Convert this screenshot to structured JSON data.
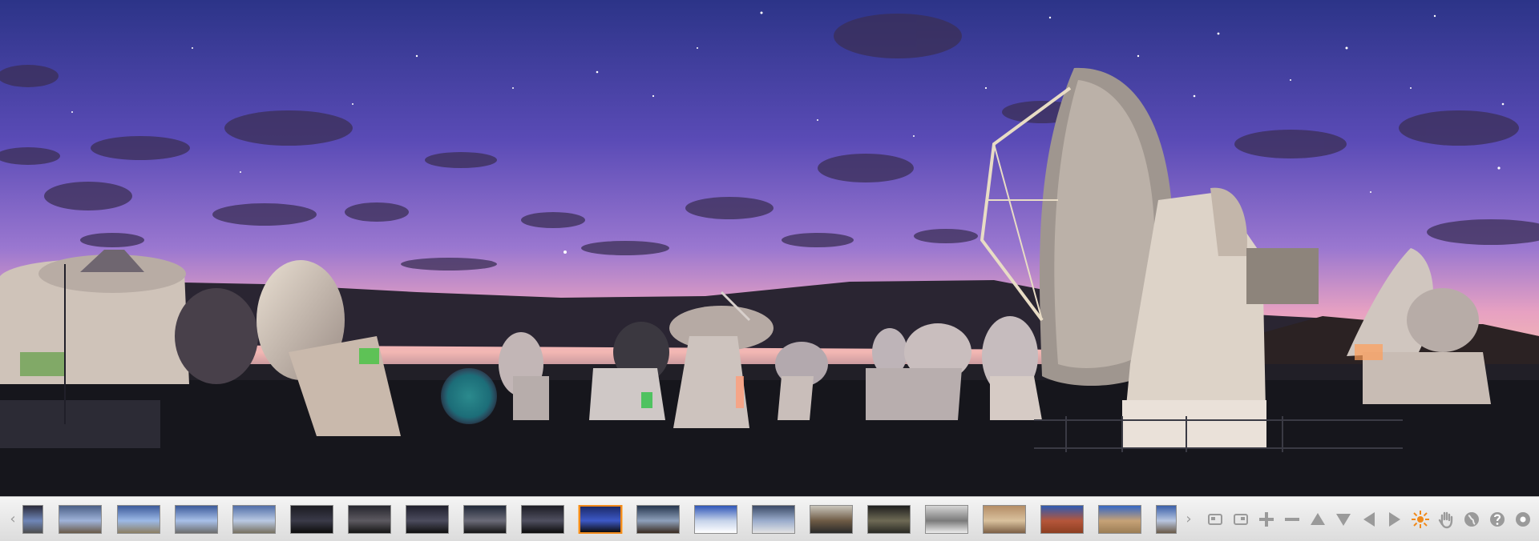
{
  "viewer": {
    "previous_label": "‹",
    "next_label": "›"
  },
  "thumbnails": [
    {
      "colors": [
        "#2a2a3a",
        "#6f86b8",
        "#4d4d4d"
      ]
    },
    {
      "colors": [
        "#4a5f86",
        "#9fb3d9",
        "#6a5a48"
      ]
    },
    {
      "colors": [
        "#3c5a9a",
        "#9cb9e6",
        "#8d7f63"
      ]
    },
    {
      "colors": [
        "#3c5a9a",
        "#a8c0e8",
        "#6d6d6d"
      ]
    },
    {
      "colors": [
        "#516ea8",
        "#b9c9e3",
        "#777060"
      ]
    },
    {
      "colors": [
        "#1b1b22",
        "#3a3a48",
        "#0d0d0d"
      ]
    },
    {
      "colors": [
        "#26262e",
        "#5d5a61",
        "#151515"
      ]
    },
    {
      "colors": [
        "#1f1f2c",
        "#4c4c5e",
        "#101010"
      ]
    },
    {
      "colors": [
        "#202838",
        "#6b6b78",
        "#141414"
      ]
    },
    {
      "colors": [
        "#1c1c24",
        "#505060",
        "#0b0b0b"
      ]
    },
    {
      "colors": [
        "#1b2a6a",
        "#3d59c6",
        "#0d0d10"
      ]
    },
    {
      "colors": [
        "#26364e",
        "#8ea0bb",
        "#3a2b20"
      ]
    },
    {
      "colors": [
        "#2f56b8",
        "#c6d3ea",
        "#ffffff"
      ]
    },
    {
      "colors": [
        "#3b4a66",
        "#9aaccc",
        "#e3e3e3"
      ]
    },
    {
      "colors": [
        "#c9c5bb",
        "#6e5b45",
        "#2a2a2a"
      ]
    },
    {
      "colors": [
        "#1e1e1e",
        "#6e6a55",
        "#2a2a24"
      ]
    },
    {
      "colors": [
        "#d6d6d6",
        "#7a7a7a",
        "#ededed"
      ]
    },
    {
      "colors": [
        "#b48d66",
        "#d9c19d",
        "#7d6046"
      ]
    },
    {
      "colors": [
        "#2e5ab1",
        "#b5563a",
        "#8c3f22"
      ]
    },
    {
      "colors": [
        "#3567c4",
        "#c6a277",
        "#9b7d55"
      ]
    },
    {
      "colors": [
        "#3a5fa9",
        "#b8c6e0",
        "#6a5a48"
      ]
    }
  ],
  "selected_thumbnail": 10,
  "controls": [
    {
      "name": "screen-mode-1-button",
      "icon": "window-icon"
    },
    {
      "name": "screen-mode-2-button",
      "icon": "fullscreen-icon"
    },
    {
      "name": "zoom-in-button",
      "icon": "plus-icon"
    },
    {
      "name": "zoom-out-button",
      "icon": "minus-icon"
    },
    {
      "name": "move-up-button",
      "icon": "triangle-up-icon"
    },
    {
      "name": "move-down-button",
      "icon": "triangle-down-icon"
    },
    {
      "name": "move-left-button",
      "icon": "triangle-left-icon"
    },
    {
      "name": "move-right-button",
      "icon": "triangle-right-icon"
    },
    {
      "name": "autorotate-button",
      "icon": "sun-icon"
    },
    {
      "name": "drag-mode-button",
      "icon": "hand-icon"
    },
    {
      "name": "projection-button",
      "icon": "globe-icon"
    },
    {
      "name": "help-button",
      "icon": "question-icon"
    },
    {
      "name": "info-button",
      "icon": "circle-icon"
    }
  ],
  "colors": {
    "accent": "#f08a1c",
    "control_icon": "#9a9a9a",
    "sky_top": "#2c3488",
    "sky_horizon": "#e7a1c2",
    "ground": "#16161c"
  }
}
